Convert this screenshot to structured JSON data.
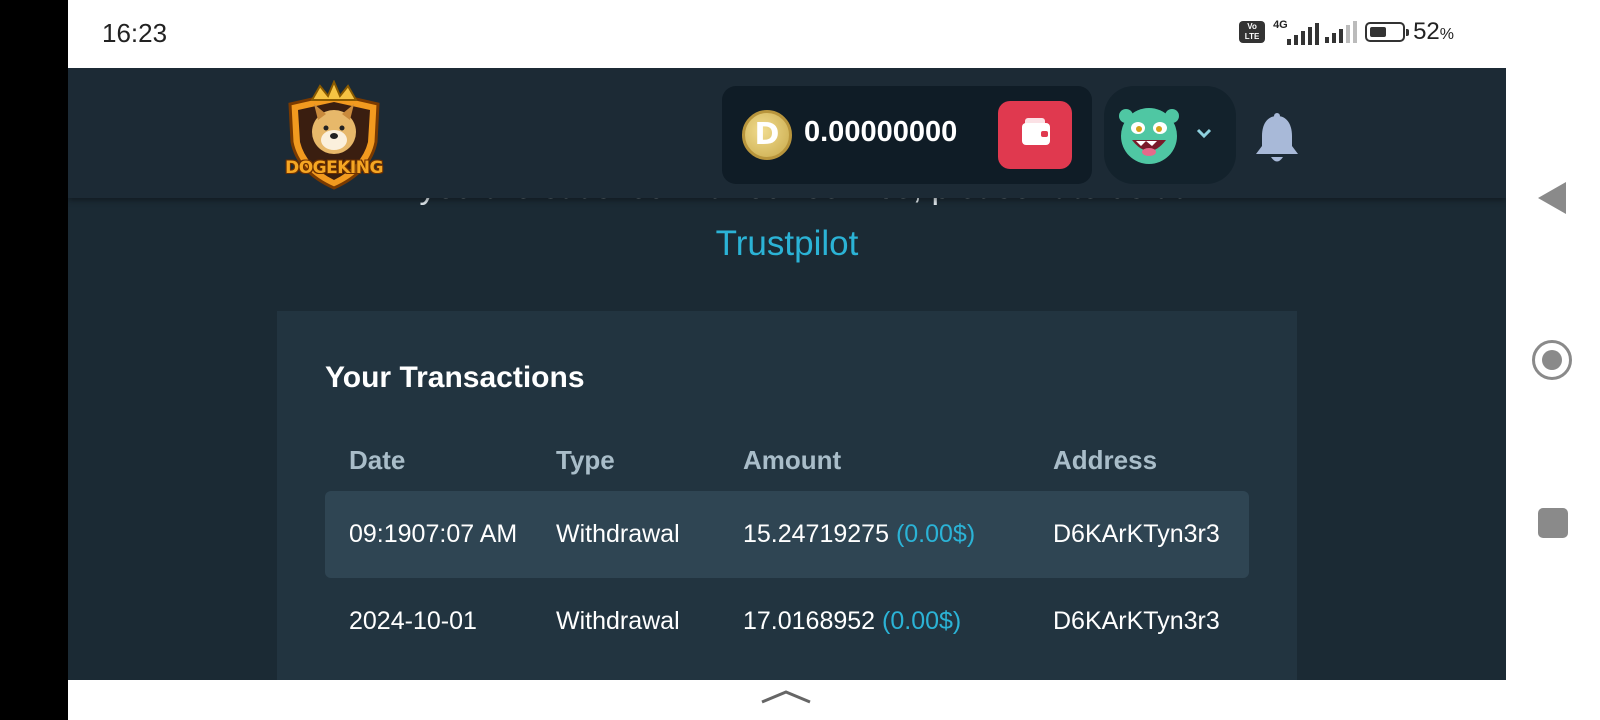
{
  "status_bar": {
    "time": "16:23",
    "volte": "Vo LTE",
    "network": "4G",
    "battery_percent": "52",
    "battery_symbol": "%",
    "battery_level": 0.52
  },
  "header": {
    "logo_text": "DOGEKING",
    "balance": "0.00000000",
    "coin_symbol": "D",
    "wallet_icon": "wallet-icon",
    "avatar_icon": "monster-avatar-icon",
    "chevron_icon": "chevron-down-icon",
    "bell_icon": "bell-icon"
  },
  "content": {
    "rate_text": "If you are satisfied with our service, please rate us at",
    "trustpilot_link": "Trustpilot"
  },
  "transactions": {
    "title": "Your Transactions",
    "columns": [
      "Date",
      "Type",
      "Amount",
      "Address"
    ],
    "rows": [
      {
        "date": "09:1907:07 AM",
        "type": "Withdrawal",
        "amount": "15.24719275",
        "usd": "(0.00$)",
        "address": "D6KArKTyn3r3"
      },
      {
        "date": "2024-10-01",
        "type": "Withdrawal",
        "amount": "17.0168952",
        "usd": "(0.00$)",
        "address": "D6KArKTyn3r3"
      }
    ]
  },
  "colors": {
    "background": "#1b2a34",
    "card": "#223440",
    "accent": "#2bb3d6",
    "wallet_button": "#e0394f"
  }
}
